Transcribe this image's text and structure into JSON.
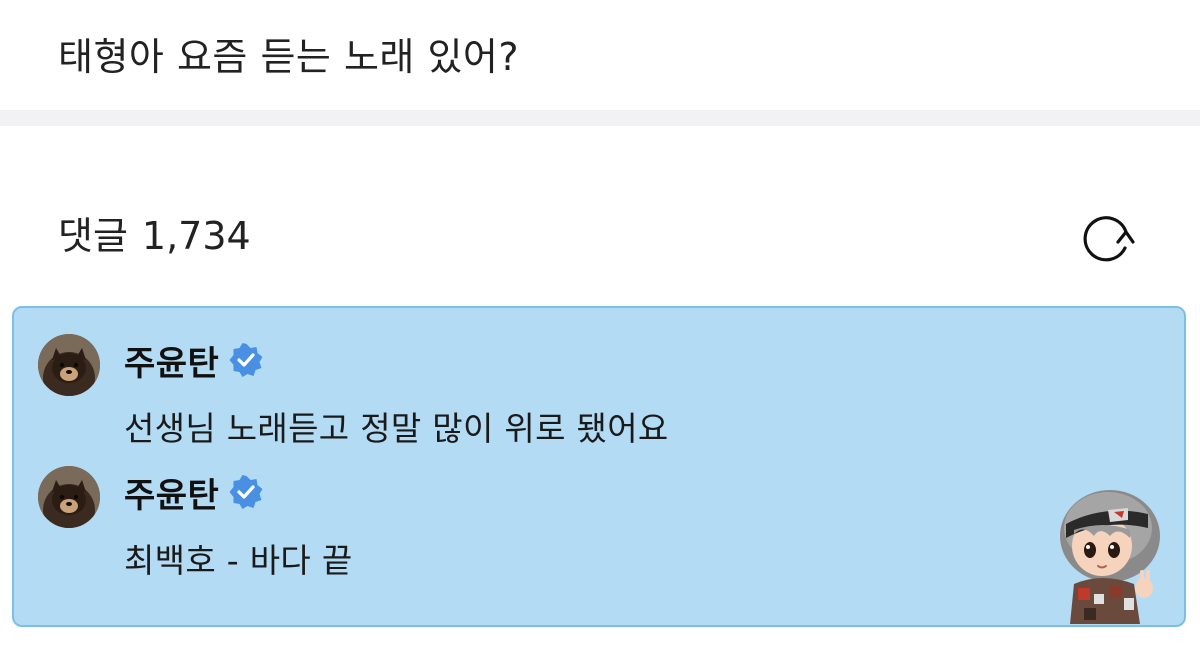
{
  "post": {
    "title": "태형아 요즘 듣는 노래 있어?"
  },
  "comments_section": {
    "label": "댓글",
    "count": "1,734",
    "refresh_icon": "refresh-icon"
  },
  "thread": {
    "background_color": "#b3dbf4",
    "border_color": "#7cbfe6",
    "comments": [
      {
        "author": "주윤탄",
        "verified": true,
        "avatar_icon": "dog-avatar",
        "text": "선생님 노래듣고 정말 많이 위로 됐어요"
      },
      {
        "author": "주윤탄",
        "verified": true,
        "avatar_icon": "dog-avatar",
        "text": "최백호 - 바다 끝"
      }
    ],
    "sticker": "character-sticker"
  },
  "colors": {
    "verified_badge": "#4a90e2",
    "divider": "#f2f2f4"
  }
}
